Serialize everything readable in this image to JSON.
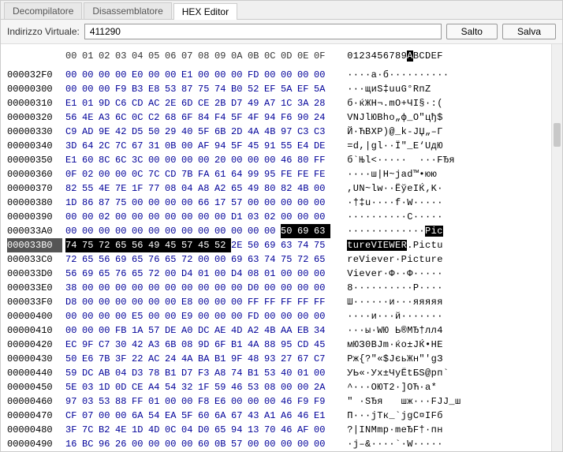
{
  "tabs": {
    "decompiler": "Decompilatore",
    "disassembler": "Disassemblatore",
    "hex": "HEX Editor"
  },
  "toolbar": {
    "addr_label": "Indirizzo Virtuale:",
    "addr_value": "411290",
    "jump": "Salto",
    "save": "Salva"
  },
  "headerCols": [
    "00",
    "01",
    "02",
    "03",
    "04",
    "05",
    "06",
    "07",
    "08",
    "09",
    "0A",
    "0B",
    "0C",
    "0D",
    "0E",
    "0F"
  ],
  "asciiHeader": "0123456789ABCDEF",
  "selection": {
    "row": "000033B0",
    "colStart": 0,
    "colEnd": 9,
    "prevAsciiTail": {
      "row": "000033A0",
      "start": 13,
      "end": 15
    }
  },
  "rows": [
    {
      "addr": "000032F0",
      "hex": [
        "00",
        "00",
        "00",
        "00",
        "E0",
        "00",
        "00",
        "E1",
        "00",
        "00",
        "00",
        "FD",
        "00",
        "00",
        "00",
        "00"
      ],
      "asc": "····а·б··········"
    },
    {
      "addr": "00000300",
      "hex": [
        "00",
        "00",
        "00",
        "F9",
        "B3",
        "E8",
        "53",
        "87",
        "75",
        "74",
        "B0",
        "52",
        "EF",
        "5A",
        "EF",
        "5A"
      ],
      "asc": "···щиS‡uuG°RпZ"
    },
    {
      "addr": "00000310",
      "hex": [
        "E1",
        "01",
        "9D",
        "C6",
        "CD",
        "AC",
        "2E",
        "6D",
        "CE",
        "2B",
        "D7",
        "49",
        "A7",
        "1C",
        "3A",
        "28"
      ],
      "asc": "б·ќЖН¬.mО+ЧI§·:("
    },
    {
      "addr": "00000320",
      "hex": [
        "56",
        "4E",
        "A3",
        "6C",
        "0C",
        "C2",
        "68",
        "6F",
        "84",
        "F4",
        "5F",
        "4F",
        "94",
        "F6",
        "90",
        "24"
      ],
      "asc": "VNJlЮBho„ф_О\"цђ$"
    },
    {
      "addr": "00000330",
      "hex": [
        "C9",
        "AD",
        "9E",
        "42",
        "D5",
        "50",
        "29",
        "40",
        "5F",
        "6B",
        "2D",
        "4A",
        "4B",
        "97",
        "C3",
        "C3"
      ],
      "asc": "Й·ЋBХP)@_k-JЏ„–Г"
    },
    {
      "addr": "00000340",
      "hex": [
        "3D",
        "64",
        "2C",
        "7C",
        "67",
        "31",
        "0B",
        "00",
        "AF",
        "94",
        "5F",
        "45",
        "91",
        "55",
        "E4",
        "DE"
      ],
      "asc": "=d,|gl··Ї\"_E‘UдЮ"
    },
    {
      "addr": "00000350",
      "hex": [
        "E1",
        "60",
        "8C",
        "6C",
        "3C",
        "00",
        "00",
        "00",
        "00",
        "20",
        "00",
        "00",
        "00",
        "46",
        "80",
        "FF"
      ],
      "asc": "б`Њl<·····  ···FЂя"
    },
    {
      "addr": "00000360",
      "hex": [
        "0F",
        "02",
        "00",
        "00",
        "0C",
        "7C",
        "CD",
        "7B",
        "FA",
        "61",
        "64",
        "99",
        "95",
        "FE",
        "FE",
        "FE"
      ],
      "asc": "····ш|Н~јаd™•юю"
    },
    {
      "addr": "00000370",
      "hex": [
        "82",
        "55",
        "4E",
        "7E",
        "1F",
        "77",
        "08",
        "04",
        "A8",
        "A2",
        "65",
        "49",
        "80",
        "82",
        "4B",
        "00"
      ],
      "asc": ",UN~lw··ЁўeIЌ‚K·"
    },
    {
      "addr": "00000380",
      "hex": [
        "1D",
        "86",
        "87",
        "75",
        "00",
        "00",
        "00",
        "00",
        "66",
        "17",
        "57",
        "00",
        "00",
        "00",
        "00",
        "00"
      ],
      "asc": "·†‡u····f·W·····"
    },
    {
      "addr": "00000390",
      "hex": [
        "00",
        "00",
        "02",
        "00",
        "00",
        "00",
        "00",
        "00",
        "00",
        "00",
        "D1",
        "03",
        "02",
        "00",
        "00",
        "00"
      ],
      "asc": "··········С·····"
    },
    {
      "addr": "000033A0",
      "hex": [
        "00",
        "00",
        "00",
        "00",
        "00",
        "00",
        "00",
        "00",
        "00",
        "00",
        "00",
        "00",
        "00",
        "50",
        "69",
        "63"
      ],
      "asc": "·············Pic"
    },
    {
      "addr": "000033B0",
      "hex": [
        "74",
        "75",
        "72",
        "65",
        "56",
        "49",
        "45",
        "57",
        "45",
        "52",
        "2E",
        "50",
        "69",
        "63",
        "74",
        "75"
      ],
      "asc": "tureVIEWER.Pictu"
    },
    {
      "addr": "000033C0",
      "hex": [
        "72",
        "65",
        "56",
        "69",
        "65",
        "76",
        "65",
        "72",
        "00",
        "00",
        "69",
        "63",
        "74",
        "75",
        "72",
        "65"
      ],
      "asc": "reViever·Picture"
    },
    {
      "addr": "000033D0",
      "hex": [
        "56",
        "69",
        "65",
        "76",
        "65",
        "72",
        "00",
        "D4",
        "01",
        "00",
        "D4",
        "08",
        "01",
        "00",
        "00",
        "00"
      ],
      "asc": "Viever·Ф··Ф·····"
    },
    {
      "addr": "000033E0",
      "hex": [
        "38",
        "00",
        "00",
        "00",
        "00",
        "00",
        "00",
        "00",
        "00",
        "00",
        "00",
        "D0",
        "00",
        "00",
        "00",
        "00"
      ],
      "asc": "8··········Р····"
    },
    {
      "addr": "000033F0",
      "hex": [
        "D8",
        "00",
        "00",
        "00",
        "00",
        "00",
        "00",
        "E8",
        "00",
        "00",
        "00",
        "FF",
        "FF",
        "FF",
        "FF",
        "FF"
      ],
      "asc": "Ш······и···яяяяя"
    },
    {
      "addr": "00000400",
      "hex": [
        "00",
        "00",
        "00",
        "00",
        "E5",
        "00",
        "00",
        "E9",
        "00",
        "00",
        "00",
        "FD",
        "00",
        "00",
        "00",
        "00"
      ],
      "asc": "····и···й·······"
    },
    {
      "addr": "00000410",
      "hex": [
        "00",
        "00",
        "00",
        "FB",
        "1A",
        "57",
        "DE",
        "A0",
        "DC",
        "AE",
        "4D",
        "A2",
        "4B",
        "AA",
        "EB",
        "34"
      ],
      "asc": "···ы·WЮ Ь®MЂ†лл4"
    },
    {
      "addr": "00000420",
      "hex": [
        "EC",
        "9F",
        "C7",
        "30",
        "42",
        "A3",
        "6B",
        "08",
        "9D",
        "6F",
        "B1",
        "4A",
        "88",
        "95",
        "CD",
        "45"
      ],
      "asc": "мЮЗ0BJm·ќo±JЌ•НЕ"
    },
    {
      "addr": "00000430",
      "hex": [
        "50",
        "E6",
        "7B",
        "3F",
        "22",
        "AC",
        "24",
        "4A",
        "BA",
        "B1",
        "9F",
        "48",
        "93",
        "27",
        "67",
        "C7"
      ],
      "asc": "Pж{?\"«$JєьЖн\"'gЗ"
    },
    {
      "addr": "00000440",
      "hex": [
        "59",
        "DC",
        "AB",
        "04",
        "D3",
        "78",
        "B1",
        "D7",
        "F3",
        "A8",
        "74",
        "B1",
        "53",
        "40",
        "01",
        "00"
      ],
      "asc": "УЬ«·Уx±ЧуЁtБS@рп`"
    },
    {
      "addr": "00000450",
      "hex": [
        "5E",
        "03",
        "1D",
        "0D",
        "CE",
        "A4",
        "54",
        "32",
        "1F",
        "59",
        "46",
        "53",
        "08",
        "00",
        "00",
        "2A"
      ],
      "asc": "^···ОЮT2·]ОЋ·а*"
    },
    {
      "addr": "00000460",
      "hex": [
        "97",
        "03",
        "53",
        "88",
        "FF",
        "01",
        "00",
        "00",
        "F8",
        "E6",
        "00",
        "00",
        "00",
        "46",
        "F9",
        "F9"
      ],
      "asc": "\" ·SЂя   шж···FЈЈ_ш"
    },
    {
      "addr": "00000470",
      "hex": [
        "CF",
        "07",
        "00",
        "00",
        "6A",
        "54",
        "EA",
        "5F",
        "60",
        "6A",
        "67",
        "43",
        "A1",
        "A6",
        "46",
        "E1"
      ],
      "asc": "П···jTк_`jgC¤ІFб"
    },
    {
      "addr": "00000480",
      "hex": [
        "3F",
        "7C",
        "B2",
        "4E",
        "1D",
        "4D",
        "0C",
        "04",
        "D0",
        "65",
        "94",
        "13",
        "70",
        "46",
        "AF",
        "00"
      ],
      "asc": "?|INMmp·meЂF†·пн"
    },
    {
      "addr": "00000490",
      "hex": [
        "16",
        "BC",
        "96",
        "26",
        "00",
        "00",
        "00",
        "00",
        "60",
        "0B",
        "57",
        "00",
        "00",
        "00",
        "00",
        "00"
      ],
      "asc": "·ј–&····`·W·····"
    }
  ]
}
